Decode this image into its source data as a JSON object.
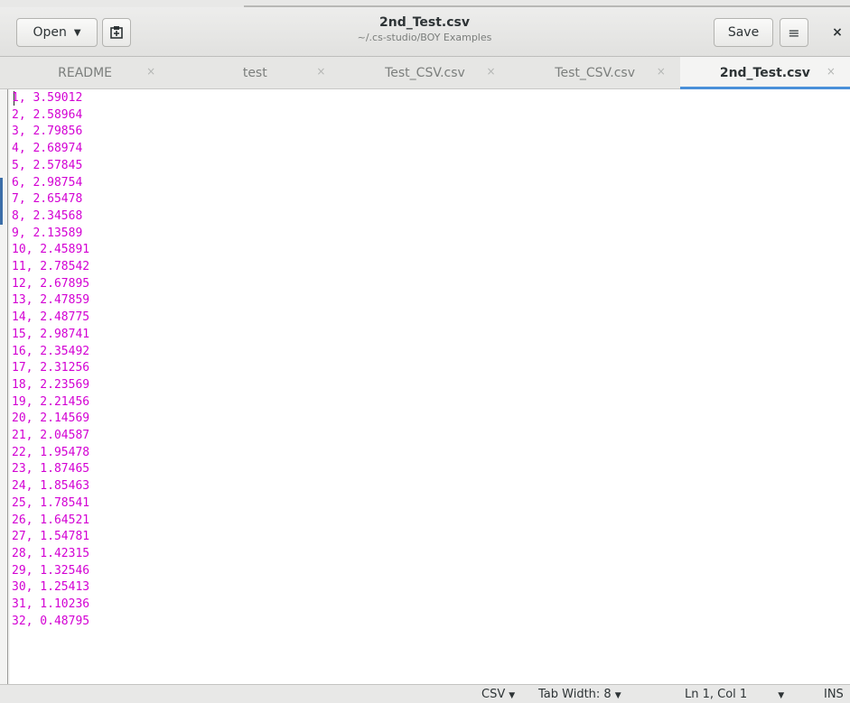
{
  "header": {
    "open_label": "Open",
    "title": "2nd_Test.csv",
    "subtitle": "~/.cs-studio/BOY Examples",
    "save_label": "Save",
    "menu_glyph": "≡",
    "close_glyph": "×",
    "new_tab_glyph": "⊞"
  },
  "tabs": [
    {
      "label": "README",
      "close": "×",
      "active": false
    },
    {
      "label": "test",
      "close": "×",
      "active": false
    },
    {
      "label": "Test_CSV.csv",
      "close": "×",
      "active": false
    },
    {
      "label": "Test_CSV.csv",
      "close": "×",
      "active": false
    },
    {
      "label": "2nd_Test.csv",
      "close": "×",
      "active": true
    }
  ],
  "editor": {
    "lines": [
      "1, 3.59012",
      "2, 2.58964",
      "3, 2.79856",
      "4, 2.68974",
      "5, 2.57845",
      "6, 2.98754",
      "7, 2.65478",
      "8, 2.34568",
      "9, 2.13589",
      "10, 2.45891",
      "11, 2.78542",
      "12, 2.67895",
      "13, 2.47859",
      "14, 2.48775",
      "15, 2.98741",
      "16, 2.35492",
      "17, 2.31256",
      "18, 2.23569",
      "19, 2.21456",
      "20, 2.14569",
      "21, 2.04587",
      "22, 1.95478",
      "23, 1.87465",
      "24, 1.85463",
      "25, 1.78541",
      "26, 1.64521",
      "27, 1.54781",
      "28, 1.42315",
      "29, 1.32546",
      "30, 1.25413",
      "31, 1.10236",
      "32, 0.48795"
    ],
    "text_color": "#d300d3"
  },
  "status": {
    "language": "CSV",
    "tab_width": "Tab Width: 8",
    "position": "Ln 1, Col 1",
    "mode": "INS"
  },
  "colors": {
    "accent": "#4a90d9"
  }
}
